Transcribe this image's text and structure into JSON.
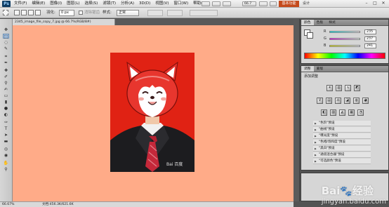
{
  "app": {
    "logo": "Ps",
    "workspace_active": "基本功能",
    "workspace_other": "设计",
    "zoom_select": "66.7"
  },
  "menu": [
    "文件(F)",
    "编辑(E)",
    "图像(I)",
    "图层(L)",
    "选择(S)",
    "滤镜(T)",
    "分析(A)",
    "3D(D)",
    "视图(V)",
    "窗口(W)",
    "帮助(H)"
  ],
  "options": {
    "feather_label": "羽化:",
    "feather_value": "0 px",
    "antialias_label": "消除锯齿",
    "style_label": "样式:",
    "style_value": "正常"
  },
  "document": {
    "tab_title": "2345_image_file_copy_7.jpg @ 66.7%(RGB/8#)"
  },
  "status": {
    "zoom": "66.67%",
    "doc_info": "文档:456.3K/621.6K"
  },
  "panel_color": {
    "tabs": [
      "颜色",
      "色板",
      "样式"
    ],
    "channels": [
      {
        "label": "R",
        "value": "235"
      },
      {
        "label": "G",
        "value": "237"
      },
      {
        "label": "B",
        "value": "241"
      }
    ]
  },
  "panel_adjust": {
    "tabs": [
      "调整",
      "蒙版"
    ],
    "header": "添加调整",
    "presets": [
      "\"色阶\"预设",
      "\"曲线\"预设",
      "\"曝光度\"预设",
      "\"色相/饱和度\"预设",
      "\"黑白\"预设",
      "\"通道混合器\"预设",
      "\"可选颜色\"预设"
    ]
  },
  "watermark": {
    "site": "jingyan.baidu.com",
    "brand": "Bai",
    "brand2": "经验",
    "photo_mark": "Bai 百度"
  },
  "colors": {
    "canvas": "#ffab88",
    "photo_bg": "#e02214",
    "workspace_btn": "#c44a1c"
  }
}
